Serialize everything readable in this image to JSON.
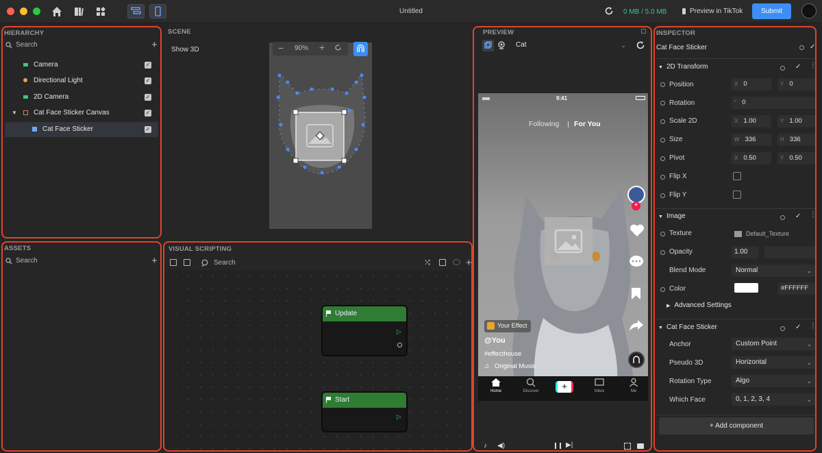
{
  "window": {
    "title": "Untitled",
    "memory": "0 MB / 5.0 MB",
    "preview_label": "Preview in TikTok",
    "submit_label": "Submit"
  },
  "hierarchy": {
    "title": "HIERARCHY",
    "search_placeholder": "Search",
    "items": [
      {
        "label": "Camera"
      },
      {
        "label": "Directional Light"
      },
      {
        "label": "2D Camera"
      },
      {
        "label": "Cat Face Sticker Canvas"
      },
      {
        "label": "Cat Face Sticker"
      }
    ]
  },
  "assets": {
    "title": "ASSETS",
    "search_placeholder": "Search"
  },
  "scene": {
    "title": "SCENE",
    "show3d_label": "Show 3D",
    "zoom": "90%"
  },
  "visual_scripting": {
    "title": "VISUAL SCRIPTING",
    "search_placeholder": "Search",
    "nodes": [
      {
        "label": "Update"
      },
      {
        "label": "Start"
      }
    ]
  },
  "preview": {
    "title": "PREVIEW",
    "selected_subject": "Cat",
    "phone": {
      "time": "9:41",
      "tab_following": "Following",
      "tab_foryou": "For You",
      "effect_label": "Your Effect",
      "username": "@You",
      "hashtag": "#effecthouse",
      "music": "Original Music",
      "nav": [
        "Home",
        "Discover",
        "",
        "Inbox",
        "Me"
      ]
    }
  },
  "inspector": {
    "title": "INSPECTOR",
    "object_name": "Cat Face Sticker",
    "transform": {
      "title": "2D Transform",
      "position_label": "Position",
      "pos_x_prefix": "X",
      "pos_x": "0",
      "pos_y_prefix": "Y",
      "pos_y": "0",
      "rotation_label": "Rotation",
      "rot_prefix": "°",
      "rot": "0",
      "scale_label": "Scale 2D",
      "scale_x_prefix": "X",
      "scale_x": "1.00",
      "scale_y_prefix": "Y",
      "scale_y": "1.00",
      "size_label": "Size",
      "size_w_prefix": "W",
      "size_w": "336",
      "size_h_prefix": "H",
      "size_h": "336",
      "pivot_label": "Pivot",
      "pivot_x_prefix": "X",
      "pivot_x": "0.50",
      "pivot_y_prefix": "Y",
      "pivot_y": "0.50",
      "flipx_label": "Flip X",
      "flipy_label": "Flip Y"
    },
    "image": {
      "title": "Image",
      "texture_label": "Texture",
      "texture_value": "Default_Texture",
      "opacity_label": "Opacity",
      "opacity_value": "1.00",
      "blend_label": "Blend Mode",
      "blend_value": "Normal",
      "color_label": "Color",
      "color_value": "#FFFFFF",
      "advanced_label": "Advanced Settings"
    },
    "sticker": {
      "title": "Cat Face Sticker",
      "anchor_label": "Anchor",
      "anchor_value": "Custom Point",
      "pseudo_label": "Pseudo 3D",
      "pseudo_value": "Horizontal",
      "rottype_label": "Rotation Type",
      "rottype_value": "Algo",
      "face_label": "Which Face",
      "face_value": "0, 1, 2, 3, 4"
    },
    "add_component_label": "+ Add component"
  },
  "colors": {
    "accent": "#3c8ef5",
    "highlight": "#e0442b",
    "node_green": "#2e7d32",
    "memory_green": "#3fc58a"
  }
}
